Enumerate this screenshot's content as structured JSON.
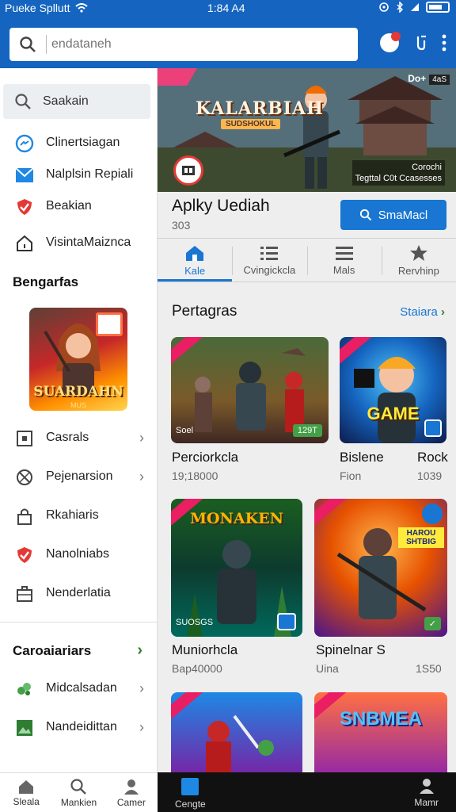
{
  "status": {
    "carrier": "Pueke Spllutt",
    "time": "1:84 A4"
  },
  "topbar": {
    "search_placeholder": "endataneh"
  },
  "sidebar": {
    "search_label": "Saakain",
    "items": [
      {
        "label": "Clinertsiagan"
      },
      {
        "label": "Nalplsin Repiali"
      },
      {
        "label": "Beakian"
      },
      {
        "label": "VisintaMaiznca"
      }
    ],
    "section1_title": "Bengarfas",
    "promo_title": "SUARDAHN",
    "promo_sub": "MUS",
    "section1_items": [
      {
        "label": "Casrals"
      },
      {
        "label": "Pejenarsion"
      },
      {
        "label": "Rkahiaris"
      },
      {
        "label": "Nanolniabs"
      },
      {
        "label": "Nenderlatia"
      }
    ],
    "section2_title": "Caroaiariars",
    "section2_items": [
      {
        "label": "Midcalsadan"
      },
      {
        "label": "Nandeidittan"
      }
    ]
  },
  "bottom_nav_left": [
    "Sleala",
    "Mankien",
    "Camer"
  ],
  "bottom_nav_right": {
    "left": "Cengte",
    "right": "Mamr"
  },
  "hero": {
    "title": "KALARBIAH",
    "subtitle": "SUDSHOKUL",
    "tag_right": "Do+",
    "tag_right_badge": "4aS",
    "corner_line1": "Corochi",
    "corner_line2": "Tegttal C0t Ccasesses"
  },
  "app": {
    "name": "Aplky Uediah",
    "number": "303",
    "button": "SmaMacl"
  },
  "tabs": [
    {
      "label": "Kale",
      "icon": "home-icon",
      "active": true
    },
    {
      "label": "Cvingickcla",
      "icon": "list-icon",
      "active": false
    },
    {
      "label": "Mals",
      "icon": "menu-icon",
      "active": false
    },
    {
      "label": "Rervhinp",
      "icon": "star-icon",
      "active": false
    }
  ],
  "section": {
    "title": "Pertagras",
    "more": "Staiara"
  },
  "cards": [
    {
      "title": "Perciorkcla",
      "sub": "19;18000",
      "tag": "Soel",
      "pill": "129T"
    },
    {
      "title": "Bislene",
      "sub": "Fion",
      "extra_title": "Rock",
      "extra_sub": "1039",
      "overlay": "GAME"
    },
    {
      "title": "Muniorhcla",
      "sub": "Bap40000",
      "tag": "SUOSGS",
      "overlay": "MONAKEN"
    },
    {
      "title": "Spinelnar S",
      "sub": "Uina",
      "extra_sub": "1S50",
      "overlay": "HAROU SHTBIG"
    },
    {
      "overlay": "SNBMEA"
    }
  ],
  "colors": {
    "brand": "#1565c0",
    "accent": "#1976d2",
    "ribbon": "#e91e63"
  }
}
